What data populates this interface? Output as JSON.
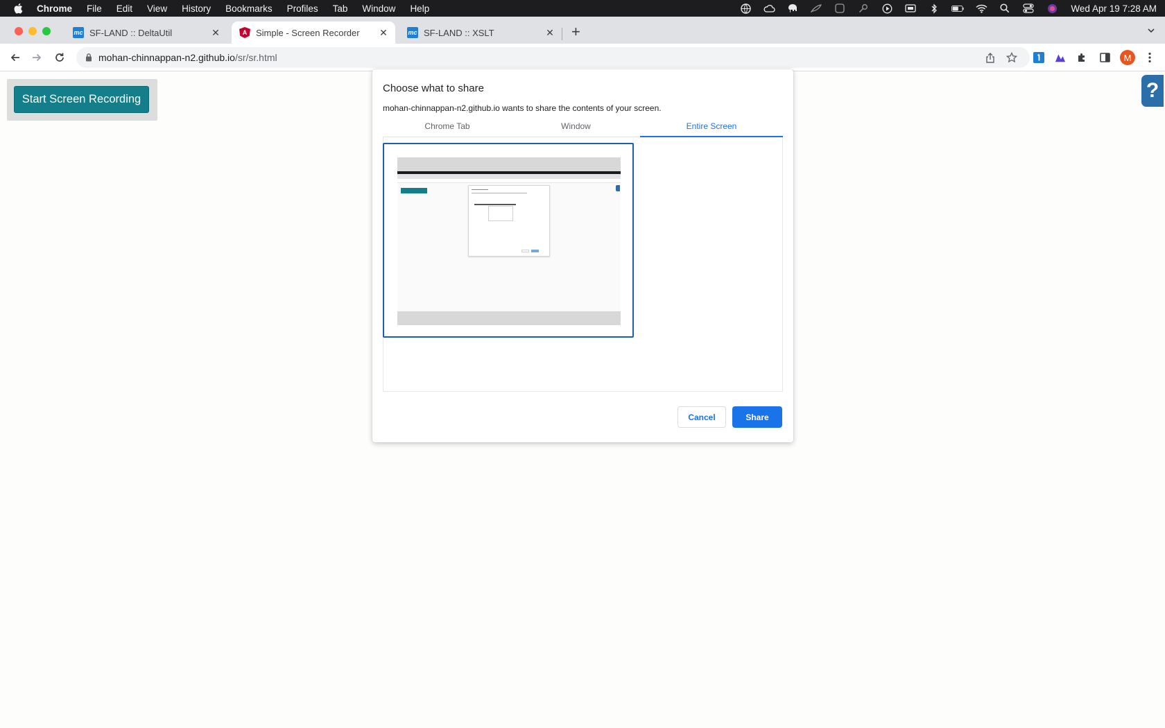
{
  "menubar": {
    "app": "Chrome",
    "items": [
      "File",
      "Edit",
      "View",
      "History",
      "Bookmarks",
      "Profiles",
      "Tab",
      "Window",
      "Help"
    ],
    "clock": "Wed Apr 19  7:28 AM"
  },
  "tabs": [
    {
      "title": "SF-LAND :: DeltaUtil",
      "favicon": "mc-icon",
      "active": false
    },
    {
      "title": "Simple - Screen Recorder",
      "favicon": "angular-icon",
      "active": true
    },
    {
      "title": "SF-LAND :: XSLT",
      "favicon": "mc-icon",
      "active": false
    }
  ],
  "favicon_text": {
    "mc": "mc",
    "angular": "A"
  },
  "omnibox": {
    "host": "mohan-chinnappan-n2.github.io",
    "path": "/sr/sr.html"
  },
  "profile": {
    "initial": "M"
  },
  "page": {
    "record_button": "Start Screen Recording",
    "help_label": "?"
  },
  "dialog": {
    "title": "Choose what to share",
    "subtitle": "mohan-chinnappan-n2.github.io wants to share the contents of your screen.",
    "tabs": [
      "Chrome Tab",
      "Window",
      "Entire Screen"
    ],
    "active_tab": "Entire Screen",
    "cancel_label": "Cancel",
    "share_label": "Share"
  },
  "colors": {
    "accent": "#1a73e8",
    "record_button": "#147f8a",
    "help_badge": "#2c6ea8"
  }
}
